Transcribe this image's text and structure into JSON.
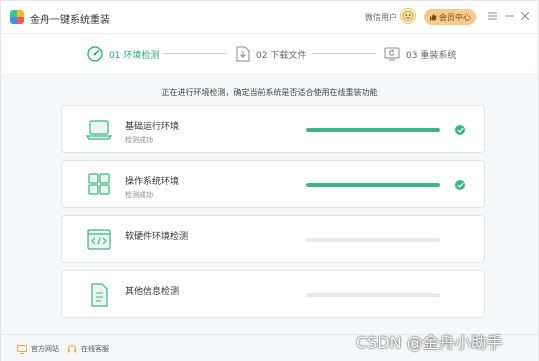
{
  "app": {
    "title": "金舟一键系统重装"
  },
  "header": {
    "user_label": "微信用户",
    "vip_label": "会员中心"
  },
  "steps": [
    {
      "label": "01 环境检测",
      "active": true,
      "icon": "gauge-icon"
    },
    {
      "label": "02 下载文件",
      "active": false,
      "icon": "download-file-icon"
    },
    {
      "label": "03 重装系统",
      "active": false,
      "icon": "reinstall-icon"
    }
  ],
  "notice": "正在进行环境检测，确定当前系统是否适合使用在线重装功能",
  "checks": [
    {
      "title": "基础运行环境",
      "status": "检测成功",
      "progress": 1.0,
      "done": true,
      "icon": "laptop-icon"
    },
    {
      "title": "操作系统环境",
      "status": "检测成功",
      "progress": 1.0,
      "done": true,
      "icon": "windows-grid-icon"
    },
    {
      "title": "软硬件环境检测",
      "status": "",
      "progress": 0,
      "done": false,
      "icon": "code-window-icon"
    },
    {
      "title": "其他信息检测",
      "status": "",
      "progress": 0,
      "done": false,
      "icon": "document-icon"
    }
  ],
  "footer": {
    "website_label": "官方网站",
    "service_label": "在线客服"
  },
  "watermark": "CSDN @金舟小助手",
  "colors": {
    "accent": "#3bb587",
    "vip": "#f6c98d"
  }
}
